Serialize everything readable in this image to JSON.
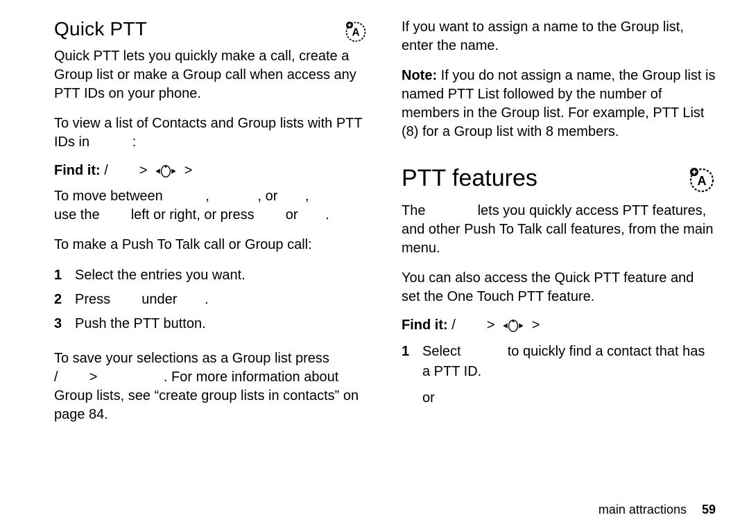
{
  "left": {
    "heading": "Quick PTT",
    "p1": "Quick PTT lets you quickly make a call, create a Group list or make a Group call when access any PTT IDs on your phone.",
    "p2_a": "To view a list of Contacts and Group lists with PTT IDs in",
    "p2_b": ":",
    "findit_label": "Find it:",
    "findit_slash": "/",
    "findit_gt1": ">",
    "findit_gt2": ">",
    "p3_a": "To move between",
    "p3_b": ",",
    "p3_c": ", or",
    "p3_d": ",",
    "p3_e": "use the",
    "p3_f": "left or right, or press",
    "p3_g": "or",
    "p3_h": ".",
    "p4": "To make a Push To Talk call or Group call:",
    "step1": "Select the entries you want.",
    "step2_a": "Press",
    "step2_b": "under",
    "step2_c": ".",
    "step3": "Push the PTT button.",
    "p5_a": "To save your selections as a Group list press",
    "p5_slash": "/",
    "p5_gt": ">",
    "p5_b": ". For more information about Group lists, see “create group lists in contacts” on page 84."
  },
  "right": {
    "p1": "If you want to assign a name to the Group list, enter the name.",
    "note_label": "Note:",
    "note_body": " If you do not assign a name, the Group list is named PTT List followed by the number of members in the Group list. For example, PTT List (8) for a Group list with 8 members.",
    "heading": "PTT features",
    "p2_a": "The",
    "p2_b": "lets you quickly access PTT features, and other Push To Talk call features, from the main menu.",
    "p3": "You can also access the Quick PTT feature and set the One Touch PTT feature.",
    "findit_label": "Find it:",
    "findit_slash": "/",
    "findit_gt1": ">",
    "findit_gt2": ">",
    "step1_a": "Select",
    "step1_b": "to quickly find a contact that has a PTT ID.",
    "or": "or"
  },
  "footer": {
    "section": "main attractions",
    "page": "59"
  }
}
